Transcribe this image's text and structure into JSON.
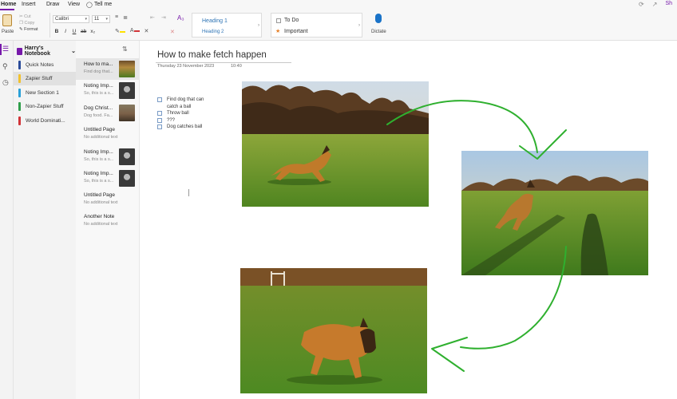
{
  "menu": {
    "tabs": [
      "Home",
      "Insert",
      "Draw",
      "View"
    ],
    "tell_me": "Tell me",
    "share": "Sh"
  },
  "ribbon": {
    "paste": "Paste",
    "cut": "Cut",
    "copy": "Copy",
    "format": "Format",
    "font_name": "Calibri",
    "font_size": "11",
    "styles": [
      "Heading 1",
      "Heading 2"
    ],
    "tags": [
      "To Do",
      "Important"
    ],
    "dictate": "Dictate"
  },
  "notebook": {
    "name": "Harry's Notebook",
    "sections": [
      {
        "label": "Quick Notes",
        "color": "#2b4c9a"
      },
      {
        "label": "Zapier Stuff",
        "color": "#f2c12e"
      },
      {
        "label": "New Section 1",
        "color": "#2aa0d8"
      },
      {
        "label": "Non-Zapier Stuff",
        "color": "#2e9e4a"
      },
      {
        "label": "World Dominati...",
        "color": "#d13438"
      }
    ]
  },
  "pages": [
    {
      "title": "How to ma...",
      "snippet": "Find dog that...",
      "thumb": "dog"
    },
    {
      "title": "Noting Imp...",
      "snippet": "So, this is a s...",
      "thumb": "face"
    },
    {
      "title": "Dog Christ...",
      "snippet": "Dog food. Fa...",
      "thumb": "dog2"
    },
    {
      "title": "Untitled Page",
      "snippet": "No additional text",
      "thumb": ""
    },
    {
      "title": "Noting Imp...",
      "snippet": "So, this is a s...",
      "thumb": "face"
    },
    {
      "title": "Noting Imp...",
      "snippet": "So, this is a s...",
      "thumb": "face"
    },
    {
      "title": "Untitled Page",
      "snippet": "No additional text",
      "thumb": ""
    },
    {
      "title": "Another Note",
      "snippet": "No additional text",
      "thumb": ""
    }
  ],
  "page": {
    "title": "How to make fetch happen",
    "date": "Thursday 23 November 2023",
    "time": "10:40",
    "todo_lines": [
      "Find dog that can",
      "catch a ball",
      "Throw ball",
      "???",
      "Dog catches ball"
    ]
  },
  "colors": {
    "accent": "#7719aa",
    "ink": "#2fb02f",
    "heading_blue": "#2e74b5"
  }
}
